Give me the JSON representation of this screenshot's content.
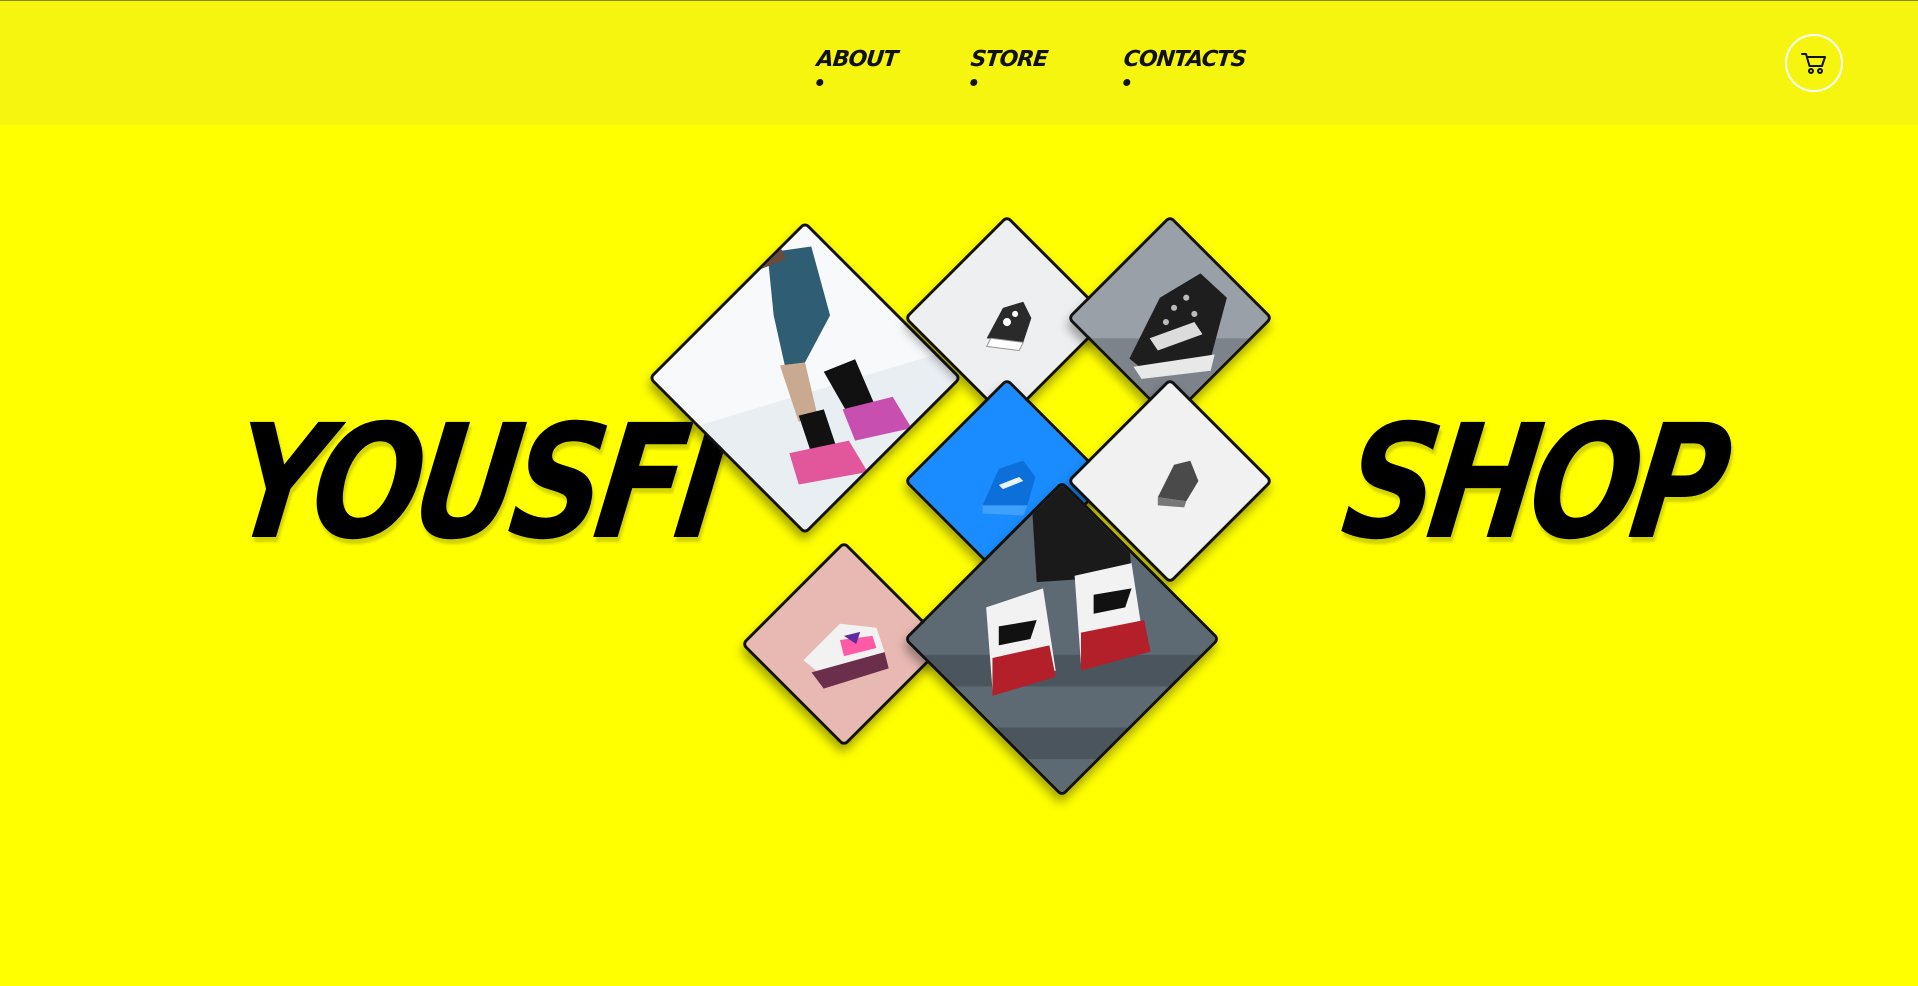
{
  "nav": {
    "items": [
      {
        "label": "About"
      },
      {
        "label": "Store"
      },
      {
        "label": "Contacts"
      }
    ]
  },
  "cart": {
    "icon": "cart-icon"
  },
  "hero": {
    "left_word": "Yousfi",
    "right_word": "Shop"
  },
  "colors": {
    "background": "#ffff00",
    "header": "#f5f50f",
    "text": "#000000",
    "accent_blue": "#1a8cff"
  },
  "collage": {
    "tiles": [
      {
        "name": "tile-jumping-runner",
        "subject": "runner mid-air wearing pink sneakers"
      },
      {
        "name": "tile-small-sneaker",
        "subject": "small black and white sneaker on white"
      },
      {
        "name": "tile-knit-sneaker",
        "subject": "black knit sneaker close-up"
      },
      {
        "name": "tile-blue-sneaker",
        "subject": "blue sneaker on blue background"
      },
      {
        "name": "tile-grey-sneaker",
        "subject": "grey sneaker on white"
      },
      {
        "name": "tile-pink-sneaker",
        "subject": "pink sneaker on pink background"
      },
      {
        "name": "tile-red-high-tops",
        "subject": "red and white high-top sneakers on steps"
      }
    ]
  }
}
